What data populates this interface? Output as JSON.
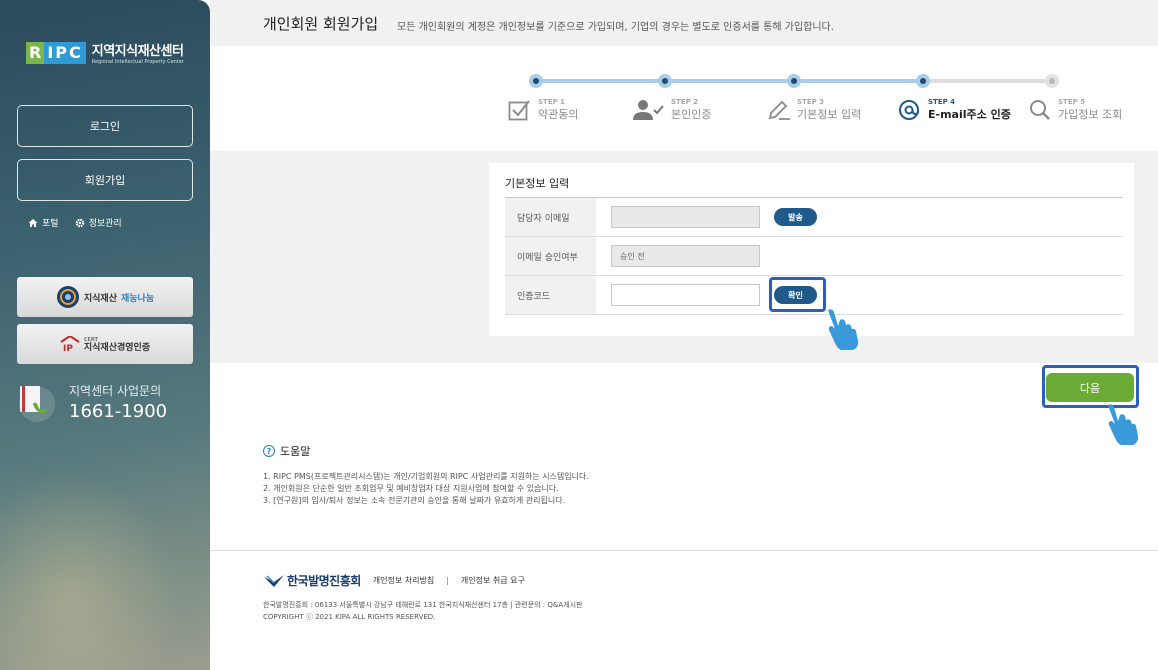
{
  "sidebar": {
    "logo": {
      "r": "R",
      "ipc": "IPC",
      "title": "지역지식재산센터",
      "subtitle": "Regional Intellectual Property Center"
    },
    "login_label": "로그인",
    "signup_label": "회원가입",
    "links": [
      {
        "label": "포털",
        "icon": "home-icon"
      },
      {
        "label": "정보관리",
        "icon": "gear-icon"
      }
    ],
    "banner1": {
      "text_a": "지식재산",
      "text_b": "재능나눔"
    },
    "banner2": {
      "small": "CERT",
      "text": "지식재산경영인증"
    },
    "contact": {
      "label": "지역센터 사업문의",
      "number": "1661-1900"
    }
  },
  "header": {
    "title": "개인회원 회원가입",
    "description": "모든 개인회원의 계정은 개인정보를 기준으로 가입되며, 기업의 경우는 별도로 인증서를 통해 가입합니다."
  },
  "steps": [
    {
      "no": "STEP 1",
      "label": "약관동의",
      "icon": "checkbox-icon",
      "state": "done"
    },
    {
      "no": "STEP 2",
      "label": "본인인증",
      "icon": "user-check-icon",
      "state": "done"
    },
    {
      "no": "STEP 3",
      "label": "기본정보 입력",
      "icon": "pencil-icon",
      "state": "done"
    },
    {
      "no": "STEP 4",
      "label": "E-mail주소 인증",
      "icon": "at-icon",
      "state": "active"
    },
    {
      "no": "STEP 5",
      "label": "가입정보 조회",
      "icon": "search-icon",
      "state": "pending"
    }
  ],
  "form": {
    "title": "기본정보 입력",
    "rows": {
      "email": {
        "label": "담당자 이메일",
        "value": "",
        "button": "발송"
      },
      "approval": {
        "label": "이메일 승인여부",
        "value": "승인 전"
      },
      "code": {
        "label": "인증코드",
        "value": "",
        "button": "확인"
      }
    }
  },
  "next_label": "다음",
  "help": {
    "title": "도움말",
    "items": [
      "1. RIPC PMS(프로젝트관리시스템)는 개인/기업회원의 RIPC 사업관리를 지원하는 시스템입니다.",
      "2. 개인회원은 단순한 일반 조회업무 및 예비창업자 대상 지원사업에 참여할 수 있습니다.",
      "3. [연구원]의 입사/퇴사 정보는 소속 전문기관의 승인을 통해 날짜가 유효하게 관리됩니다."
    ]
  },
  "footer": {
    "org": "한국발명진흥회",
    "privacy_policy": "개인정보 처리방침",
    "privacy_request": "개인정보 취급 요구",
    "separator": "|",
    "address": "한국발명진흥회 : 06133 서울특별시 강남구 테헤란로 131 한국지식재산센터 17층 | 관련문의 : Q&A게시판",
    "copyright": "COPYRIGHT ⓒ 2021 KIPA ALL RIGHTS RESERVED."
  },
  "colors": {
    "accent": "#1f5a8b",
    "next": "#6aaa35",
    "highlight": "#2b5fbf",
    "track_done": "#a9cde9",
    "track_pending": "#dddddd"
  }
}
